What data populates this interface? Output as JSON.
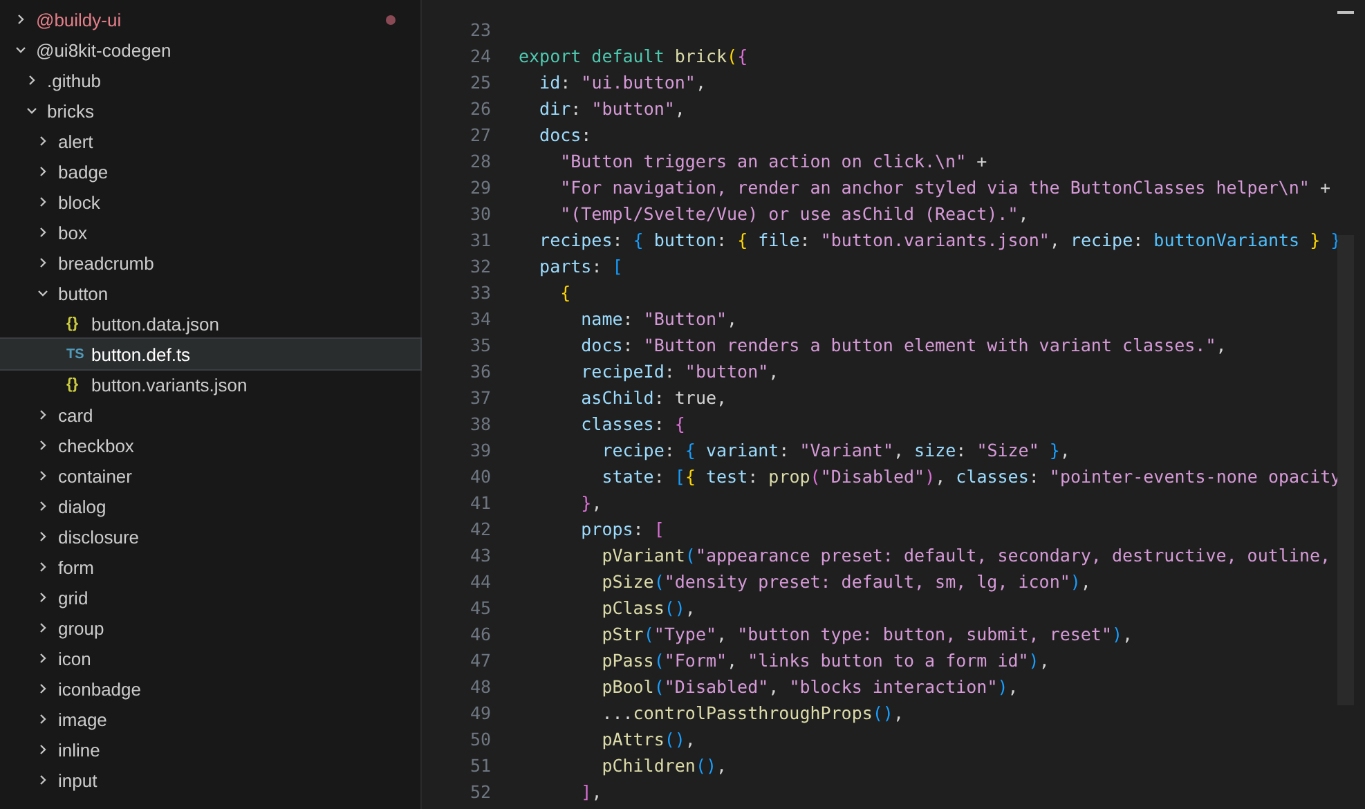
{
  "explorer": {
    "items": [
      {
        "label": "@buildy-ui",
        "kind": "folder",
        "expanded": false,
        "modified": true
      },
      {
        "label": "@ui8kit-codegen",
        "kind": "folder",
        "expanded": true,
        "modified": false,
        "children": [
          {
            "label": ".github",
            "kind": "folder",
            "expanded": false,
            "modified": false
          },
          {
            "label": "bricks",
            "kind": "folder",
            "expanded": true,
            "modified": false,
            "children": [
              {
                "label": "alert",
                "kind": "folder",
                "expanded": false,
                "modified": false
              },
              {
                "label": "badge",
                "kind": "folder",
                "expanded": false,
                "modified": false
              },
              {
                "label": "block",
                "kind": "folder",
                "expanded": false,
                "modified": false
              },
              {
                "label": "box",
                "kind": "folder",
                "expanded": false,
                "modified": false
              },
              {
                "label": "breadcrumb",
                "kind": "folder",
                "expanded": false,
                "modified": false
              },
              {
                "label": "button",
                "kind": "folder",
                "expanded": true,
                "modified": false,
                "children": [
                  {
                    "label": "button.data.json",
                    "kind": "json",
                    "icon": "{}",
                    "selected": false
                  },
                  {
                    "label": "button.def.ts",
                    "kind": "ts",
                    "icon": "TS",
                    "selected": true
                  },
                  {
                    "label": "button.variants.json",
                    "kind": "json",
                    "icon": "{}",
                    "selected": false
                  }
                ]
              },
              {
                "label": "card",
                "kind": "folder",
                "expanded": false,
                "modified": false
              },
              {
                "label": "checkbox",
                "kind": "folder",
                "expanded": false,
                "modified": false
              },
              {
                "label": "container",
                "kind": "folder",
                "expanded": false,
                "modified": false
              },
              {
                "label": "dialog",
                "kind": "folder",
                "expanded": false,
                "modified": false
              },
              {
                "label": "disclosure",
                "kind": "folder",
                "expanded": false,
                "modified": false
              },
              {
                "label": "form",
                "kind": "folder",
                "expanded": false,
                "modified": false
              },
              {
                "label": "grid",
                "kind": "folder",
                "expanded": false,
                "modified": false
              },
              {
                "label": "group",
                "kind": "folder",
                "expanded": false,
                "modified": false
              },
              {
                "label": "icon",
                "kind": "folder",
                "expanded": false,
                "modified": false
              },
              {
                "label": "iconbadge",
                "kind": "folder",
                "expanded": false,
                "modified": false
              },
              {
                "label": "image",
                "kind": "folder",
                "expanded": false,
                "modified": false
              },
              {
                "label": "inline",
                "kind": "folder",
                "expanded": false,
                "modified": false
              },
              {
                "label": "input",
                "kind": "folder",
                "expanded": false,
                "modified": false
              }
            ]
          }
        ]
      }
    ]
  },
  "editor": {
    "lines": [
      {
        "number": "23"
      },
      {
        "number": "24",
        "tokens": [
          {
            "t": "export default ",
            "kind": "kw"
          },
          {
            "t": "brick",
            "kind": "fn"
          },
          {
            "t": "(",
            "kind": "b1"
          },
          {
            "t": "{",
            "kind": "b2"
          }
        ]
      },
      {
        "number": "25",
        "tokens": [
          {
            "t": "  id",
            "kind": "prop"
          },
          {
            "t": ": ",
            "kind": "plain"
          },
          {
            "t": "\"ui.button\"",
            "kind": "str"
          },
          {
            "t": ",",
            "kind": "plain"
          }
        ]
      },
      {
        "number": "26",
        "tokens": [
          {
            "t": "  dir",
            "kind": "prop"
          },
          {
            "t": ": ",
            "kind": "plain"
          },
          {
            "t": "\"button\"",
            "kind": "str"
          },
          {
            "t": ",",
            "kind": "plain"
          }
        ]
      },
      {
        "number": "27",
        "tokens": [
          {
            "t": "  docs",
            "kind": "prop"
          },
          {
            "t": ":",
            "kind": "plain"
          }
        ]
      },
      {
        "number": "28",
        "tokens": [
          {
            "t": "    \"Button triggers an action on click.\\n\"",
            "kind": "str"
          },
          {
            "t": " +",
            "kind": "plain"
          }
        ]
      },
      {
        "number": "29",
        "tokens": [
          {
            "t": "    \"For navigation, render an anchor styled via the ButtonClasses helper\\n\"",
            "kind": "str"
          },
          {
            "t": " +",
            "kind": "plain"
          }
        ]
      },
      {
        "number": "30",
        "tokens": [
          {
            "t": "    \"(Templ/Svelte/Vue) or use asChild (React).\"",
            "kind": "str"
          },
          {
            "t": ",",
            "kind": "plain"
          }
        ]
      },
      {
        "number": "31",
        "tokens": [
          {
            "t": "  recipes",
            "kind": "prop"
          },
          {
            "t": ": ",
            "kind": "plain"
          },
          {
            "t": "{",
            "kind": "b3"
          },
          {
            "t": " button",
            "kind": "prop"
          },
          {
            "t": ": ",
            "kind": "plain"
          },
          {
            "t": "{",
            "kind": "b1"
          },
          {
            "t": " file",
            "kind": "prop"
          },
          {
            "t": ": ",
            "kind": "plain"
          },
          {
            "t": "\"button.variants.json\"",
            "kind": "str"
          },
          {
            "t": ", ",
            "kind": "plain"
          },
          {
            "t": "recipe",
            "kind": "prop"
          },
          {
            "t": ": ",
            "kind": "plain"
          },
          {
            "t": "buttonVariants ",
            "kind": "var"
          },
          {
            "t": "}",
            "kind": "b1"
          },
          {
            "t": " }",
            "kind": "b3"
          }
        ]
      },
      {
        "number": "32",
        "tokens": [
          {
            "t": "  parts",
            "kind": "prop"
          },
          {
            "t": ": ",
            "kind": "plain"
          },
          {
            "t": "[",
            "kind": "b3"
          }
        ]
      },
      {
        "number": "33",
        "tokens": [
          {
            "t": "    {",
            "kind": "b1"
          }
        ]
      },
      {
        "number": "34",
        "tokens": [
          {
            "t": "      name",
            "kind": "prop"
          },
          {
            "t": ": ",
            "kind": "plain"
          },
          {
            "t": "\"Button\"",
            "kind": "str"
          },
          {
            "t": ",",
            "kind": "plain"
          }
        ]
      },
      {
        "number": "35",
        "tokens": [
          {
            "t": "      docs",
            "kind": "prop"
          },
          {
            "t": ": ",
            "kind": "plain"
          },
          {
            "t": "\"Button renders a button element with variant classes.\"",
            "kind": "str"
          },
          {
            "t": ",",
            "kind": "plain"
          }
        ]
      },
      {
        "number": "36",
        "tokens": [
          {
            "t": "      recipeId",
            "kind": "prop"
          },
          {
            "t": ": ",
            "kind": "plain"
          },
          {
            "t": "\"button\"",
            "kind": "str"
          },
          {
            "t": ",",
            "kind": "plain"
          }
        ]
      },
      {
        "number": "37",
        "tokens": [
          {
            "t": "      asChild",
            "kind": "prop"
          },
          {
            "t": ": true,",
            "kind": "plain"
          }
        ]
      },
      {
        "number": "38",
        "tokens": [
          {
            "t": "      classes",
            "kind": "prop"
          },
          {
            "t": ": ",
            "kind": "plain"
          },
          {
            "t": "{",
            "kind": "b2"
          }
        ]
      },
      {
        "number": "39",
        "tokens": [
          {
            "t": "        recipe",
            "kind": "prop"
          },
          {
            "t": ": ",
            "kind": "plain"
          },
          {
            "t": "{",
            "kind": "b3"
          },
          {
            "t": " variant",
            "kind": "prop"
          },
          {
            "t": ": ",
            "kind": "plain"
          },
          {
            "t": "\"Variant\"",
            "kind": "str"
          },
          {
            "t": ", ",
            "kind": "plain"
          },
          {
            "t": "size",
            "kind": "prop"
          },
          {
            "t": ": ",
            "kind": "plain"
          },
          {
            "t": "\"Size\"",
            "kind": "str"
          },
          {
            "t": " }",
            "kind": "b3"
          },
          {
            "t": ",",
            "kind": "plain"
          }
        ]
      },
      {
        "number": "40",
        "tokens": [
          {
            "t": "        state",
            "kind": "prop"
          },
          {
            "t": ": ",
            "kind": "plain"
          },
          {
            "t": "[",
            "kind": "b3"
          },
          {
            "t": "{",
            "kind": "b1"
          },
          {
            "t": " test",
            "kind": "prop"
          },
          {
            "t": ": ",
            "kind": "plain"
          },
          {
            "t": "prop",
            "kind": "fn"
          },
          {
            "t": "(",
            "kind": "b2"
          },
          {
            "t": "\"Disabled\"",
            "kind": "str"
          },
          {
            "t": ")",
            "kind": "b2"
          },
          {
            "t": ", ",
            "kind": "plain"
          },
          {
            "t": "classes",
            "kind": "prop"
          },
          {
            "t": ": ",
            "kind": "plain"
          },
          {
            "t": "\"pointer-events-none opacity",
            "kind": "str"
          }
        ]
      },
      {
        "number": "41",
        "tokens": [
          {
            "t": "      }",
            "kind": "b2"
          },
          {
            "t": ",",
            "kind": "plain"
          }
        ]
      },
      {
        "number": "42",
        "tokens": [
          {
            "t": "      props",
            "kind": "prop"
          },
          {
            "t": ": ",
            "kind": "plain"
          },
          {
            "t": "[",
            "kind": "b2"
          }
        ]
      },
      {
        "number": "43",
        "tokens": [
          {
            "t": "        pVariant",
            "kind": "fn"
          },
          {
            "t": "(",
            "kind": "b3"
          },
          {
            "t": "\"appearance preset: default, secondary, destructive, outline,",
            "kind": "str"
          }
        ]
      },
      {
        "number": "44",
        "tokens": [
          {
            "t": "        pSize",
            "kind": "fn"
          },
          {
            "t": "(",
            "kind": "b3"
          },
          {
            "t": "\"density preset: default, sm, lg, icon\"",
            "kind": "str"
          },
          {
            "t": ")",
            "kind": "b3"
          },
          {
            "t": ",",
            "kind": "plain"
          }
        ]
      },
      {
        "number": "45",
        "tokens": [
          {
            "t": "        pClass",
            "kind": "fn"
          },
          {
            "t": "()",
            "kind": "b3"
          },
          {
            "t": ",",
            "kind": "plain"
          }
        ]
      },
      {
        "number": "46",
        "tokens": [
          {
            "t": "        pStr",
            "kind": "fn"
          },
          {
            "t": "(",
            "kind": "b3"
          },
          {
            "t": "\"Type\"",
            "kind": "str"
          },
          {
            "t": ", ",
            "kind": "plain"
          },
          {
            "t": "\"button type: button, submit, reset\"",
            "kind": "str"
          },
          {
            "t": ")",
            "kind": "b3"
          },
          {
            "t": ",",
            "kind": "plain"
          }
        ]
      },
      {
        "number": "47",
        "tokens": [
          {
            "t": "        pPass",
            "kind": "fn"
          },
          {
            "t": "(",
            "kind": "b3"
          },
          {
            "t": "\"Form\"",
            "kind": "str"
          },
          {
            "t": ", ",
            "kind": "plain"
          },
          {
            "t": "\"links button to a form id\"",
            "kind": "str"
          },
          {
            "t": ")",
            "kind": "b3"
          },
          {
            "t": ",",
            "kind": "plain"
          }
        ]
      },
      {
        "number": "48",
        "tokens": [
          {
            "t": "        pBool",
            "kind": "fn"
          },
          {
            "t": "(",
            "kind": "b3"
          },
          {
            "t": "\"Disabled\"",
            "kind": "str"
          },
          {
            "t": ", ",
            "kind": "plain"
          },
          {
            "t": "\"blocks interaction\"",
            "kind": "str"
          },
          {
            "t": ")",
            "kind": "b3"
          },
          {
            "t": ",",
            "kind": "plain"
          }
        ]
      },
      {
        "number": "49",
        "tokens": [
          {
            "t": "        ...",
            "kind": "plain"
          },
          {
            "t": "controlPassthroughProps",
            "kind": "fn"
          },
          {
            "t": "()",
            "kind": "b3"
          },
          {
            "t": ",",
            "kind": "plain"
          }
        ]
      },
      {
        "number": "50",
        "tokens": [
          {
            "t": "        pAttrs",
            "kind": "fn"
          },
          {
            "t": "()",
            "kind": "b3"
          },
          {
            "t": ",",
            "kind": "plain"
          }
        ]
      },
      {
        "number": "51",
        "tokens": [
          {
            "t": "        pChildren",
            "kind": "fn"
          },
          {
            "t": "()",
            "kind": "b3"
          },
          {
            "t": ",",
            "kind": "plain"
          }
        ]
      },
      {
        "number": "52",
        "tokens": [
          {
            "t": "      ]",
            "kind": "b2"
          },
          {
            "t": ",",
            "kind": "plain"
          }
        ]
      }
    ]
  }
}
